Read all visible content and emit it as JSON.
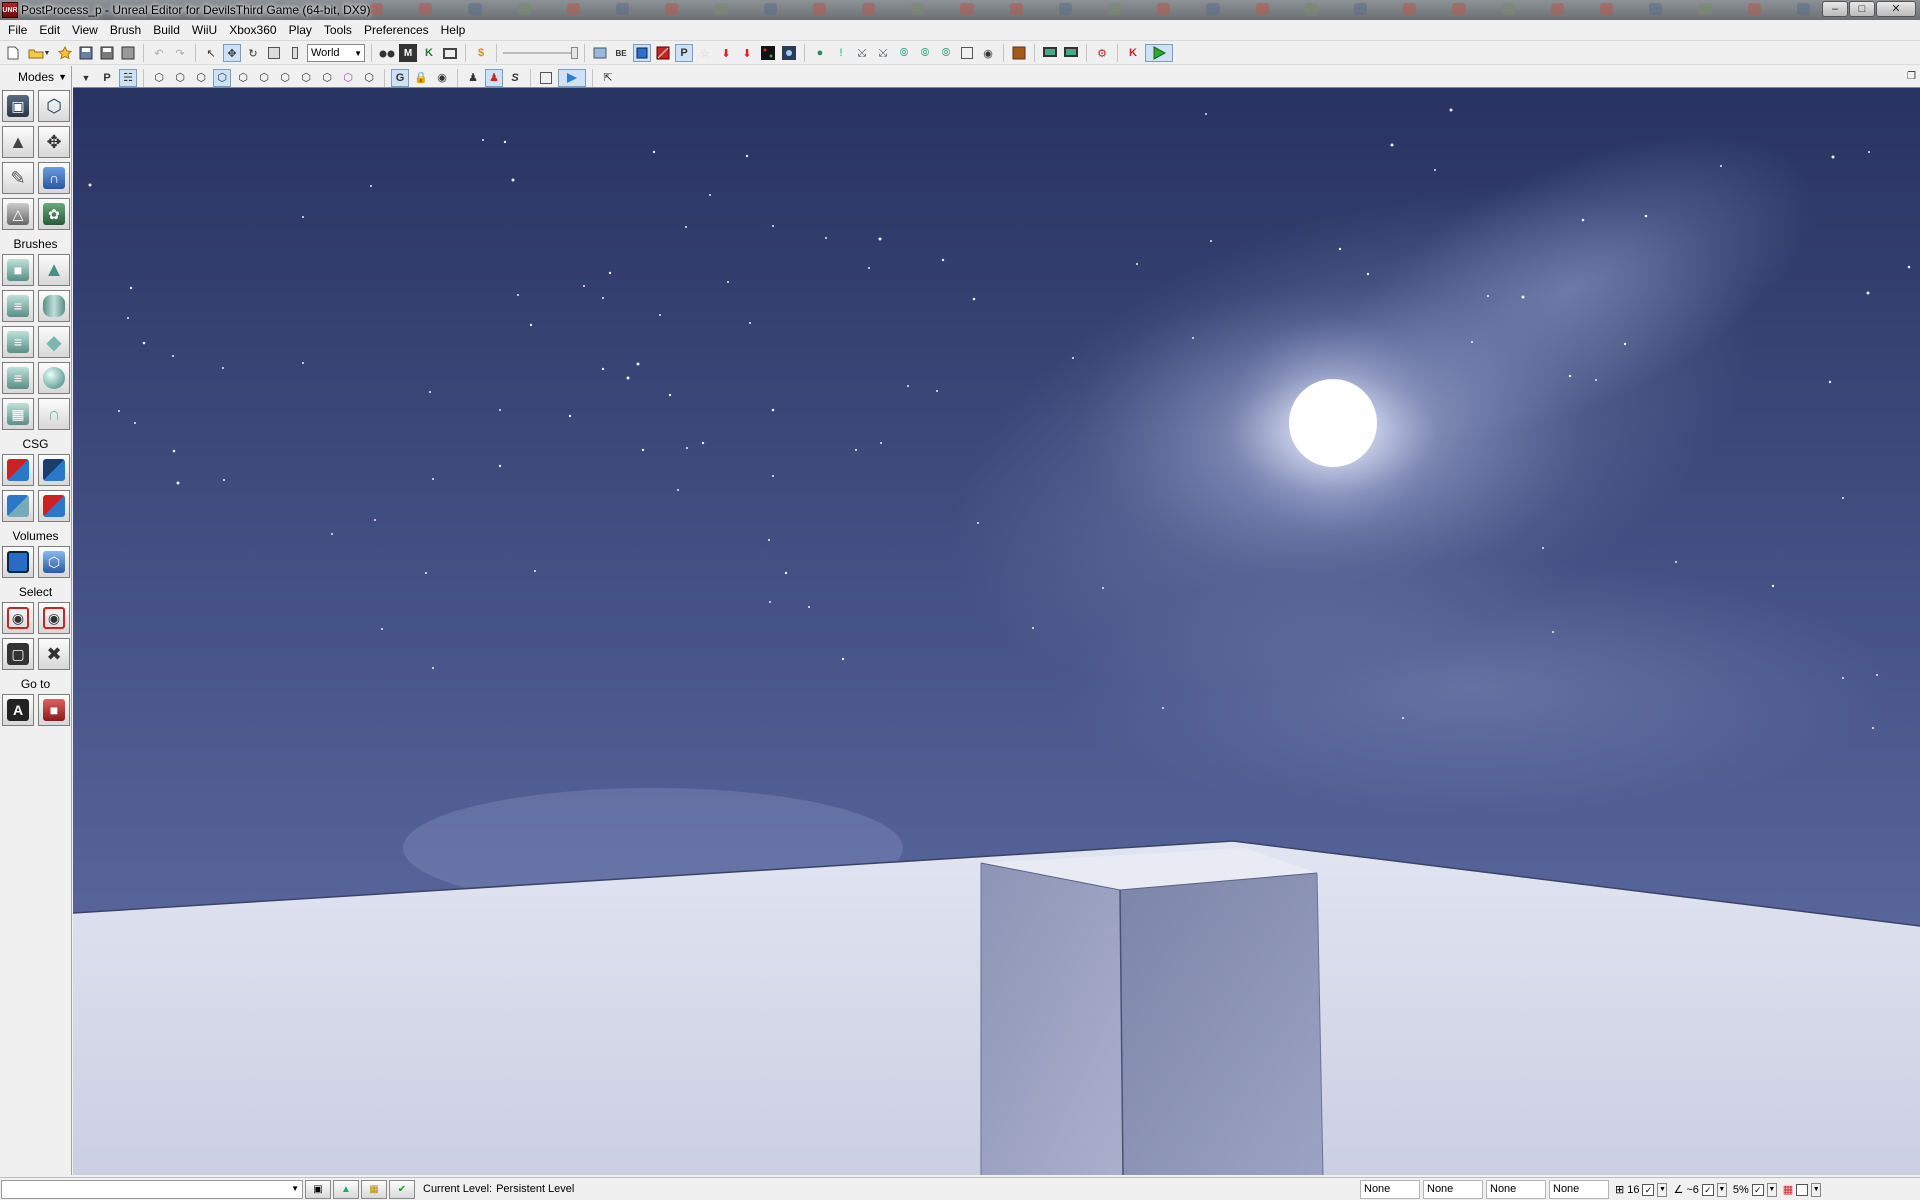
{
  "window": {
    "title": "PostProcess_p - Unreal Editor for DevilsThird Game (64-bit, DX9)",
    "app_icon_text": "UNR",
    "controls": [
      "minimize",
      "maximize",
      "close"
    ]
  },
  "menu": [
    "File",
    "Edit",
    "View",
    "Brush",
    "Build",
    "WiiU",
    "Xbox360",
    "Play",
    "Tools",
    "Preferences",
    "Help"
  ],
  "toolbar": {
    "coordinate_system": "World",
    "icons_main": [
      "new-icon",
      "open-icon",
      "save-icon",
      "save-all-icon",
      "undo-icon",
      "redo-icon",
      "select-icon",
      "translate-icon",
      "rotate-icon",
      "scale-icon",
      "nonuniform-scale-icon"
    ],
    "icons_tools": [
      "find-icon",
      "kismet-icon",
      "content-browser-icon",
      "play-in-editor-icon"
    ]
  },
  "toolbar2": {
    "p_label": "P",
    "g_label": "G",
    "s_label": "S"
  },
  "modes": {
    "title": "Modes",
    "sections": {
      "brushes": "Brushes",
      "csg": "CSG",
      "volumes": "Volumes",
      "select": "Select",
      "goto": "Go to"
    },
    "goto_a_label": "A"
  },
  "statusbar": {
    "current_level_label": "Current Level:",
    "current_level_value": "Persistent Level",
    "fields": [
      "None",
      "None",
      "None",
      "None"
    ],
    "grid_size": "16",
    "rotation_snap": "~6",
    "scale_snap": "5%"
  },
  "colors": {
    "sky_top": "#2b3560",
    "sky_mid": "#4a5685",
    "sky_horizon": "#6a79a6",
    "floor": "#d8dbea",
    "moon": "#ffffff",
    "play_green": "#2ea82e"
  }
}
